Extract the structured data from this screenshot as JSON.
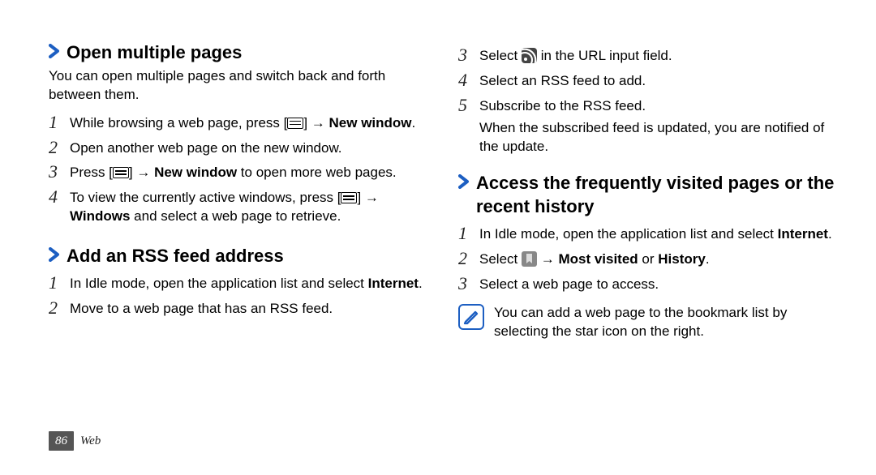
{
  "left": {
    "section1": {
      "title": "Open multiple pages",
      "intro": "You can open multiple pages and switch back and forth between them.",
      "steps": {
        "s1": {
          "num": "1",
          "t1": "While browsing a web page, press [",
          "t2": "] → ",
          "t3": "New window",
          "t4": "."
        },
        "s2": {
          "num": "2",
          "t": "Open another web page on the new window."
        },
        "s3": {
          "num": "3",
          "t1": "Press [",
          "t2": "] → ",
          "t3": "New window",
          "t4": " to open more web pages."
        },
        "s4": {
          "num": "4",
          "t1": "To view the currently active windows, press [",
          "t2": "] → ",
          "t3": "Windows",
          "t4": " and select a web page to retrieve."
        }
      }
    },
    "section2": {
      "title": "Add an RSS feed address",
      "steps": {
        "s1": {
          "num": "1",
          "t1": "In Idle mode, open the application list and select ",
          "t2": "Internet",
          "t3": "."
        },
        "s2": {
          "num": "2",
          "t": "Move to a web page that has an RSS feed."
        }
      }
    }
  },
  "right": {
    "cont_steps": {
      "s3": {
        "num": "3",
        "t1": "Select ",
        "t2": " in the URL input field."
      },
      "s4": {
        "num": "4",
        "t": "Select an RSS feed to add."
      },
      "s5": {
        "num": "5",
        "t1": "Subscribe to the RSS feed.",
        "t2": "When the subscribed feed is updated, you are notified of the update."
      }
    },
    "section3": {
      "title": "Access the frequently visited pages or the recent history",
      "steps": {
        "s1": {
          "num": "1",
          "t1": "In Idle mode, open the application list and select ",
          "t2": "Internet",
          "t3": "."
        },
        "s2": {
          "num": "2",
          "t1": "Select ",
          "t2": " → ",
          "t3": "Most visited",
          "t4": " or ",
          "t5": "History",
          "t6": "."
        },
        "s3": {
          "num": "3",
          "t": "Select a web page to access."
        }
      },
      "note": "You can add a web page to the bookmark list by selecting the star icon on the right."
    }
  },
  "footer": {
    "page_num": "86",
    "section": "Web"
  }
}
